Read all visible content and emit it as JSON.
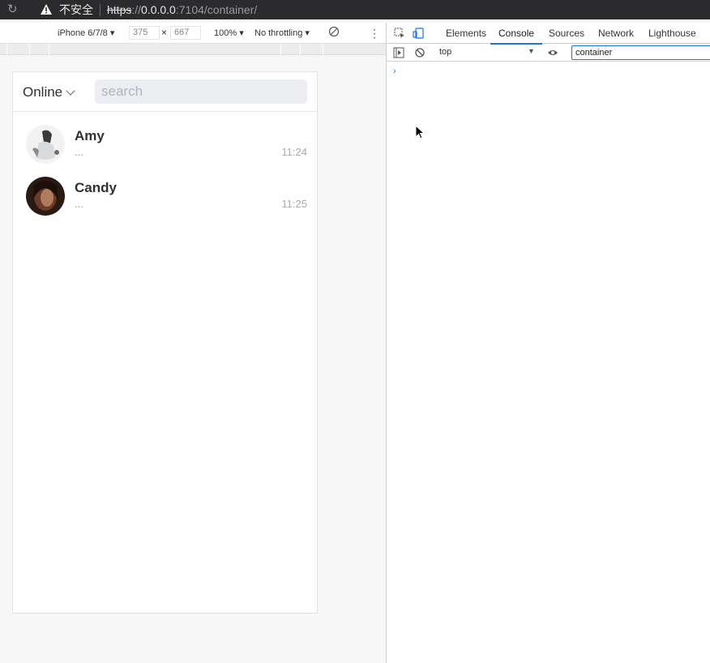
{
  "browser": {
    "insecure_label": "不安全",
    "url_scheme": "https",
    "url_sep": "://",
    "url_host": "0.0.0.0",
    "url_rest": ":7104/container/"
  },
  "device_toolbar": {
    "device": "iPhone 6/7/8",
    "width": "375",
    "times": "×",
    "height": "667",
    "zoom": "100%",
    "throttling": "No throttling",
    "more": "⋮"
  },
  "app": {
    "status": "Online",
    "search_placeholder": "search",
    "conversations": [
      {
        "name": "Amy",
        "preview": "...",
        "time": "11:24"
      },
      {
        "name": "Candy",
        "preview": "...",
        "time": "11:25"
      }
    ]
  },
  "devtools": {
    "tabs": [
      "Elements",
      "Console",
      "Sources",
      "Network",
      "Lighthouse"
    ],
    "active_tab": "Console",
    "context": "top",
    "filter_value": "container",
    "prompt": "›"
  },
  "colors": {
    "accent": "#1a73e8",
    "search_bg": "#eceef2"
  }
}
